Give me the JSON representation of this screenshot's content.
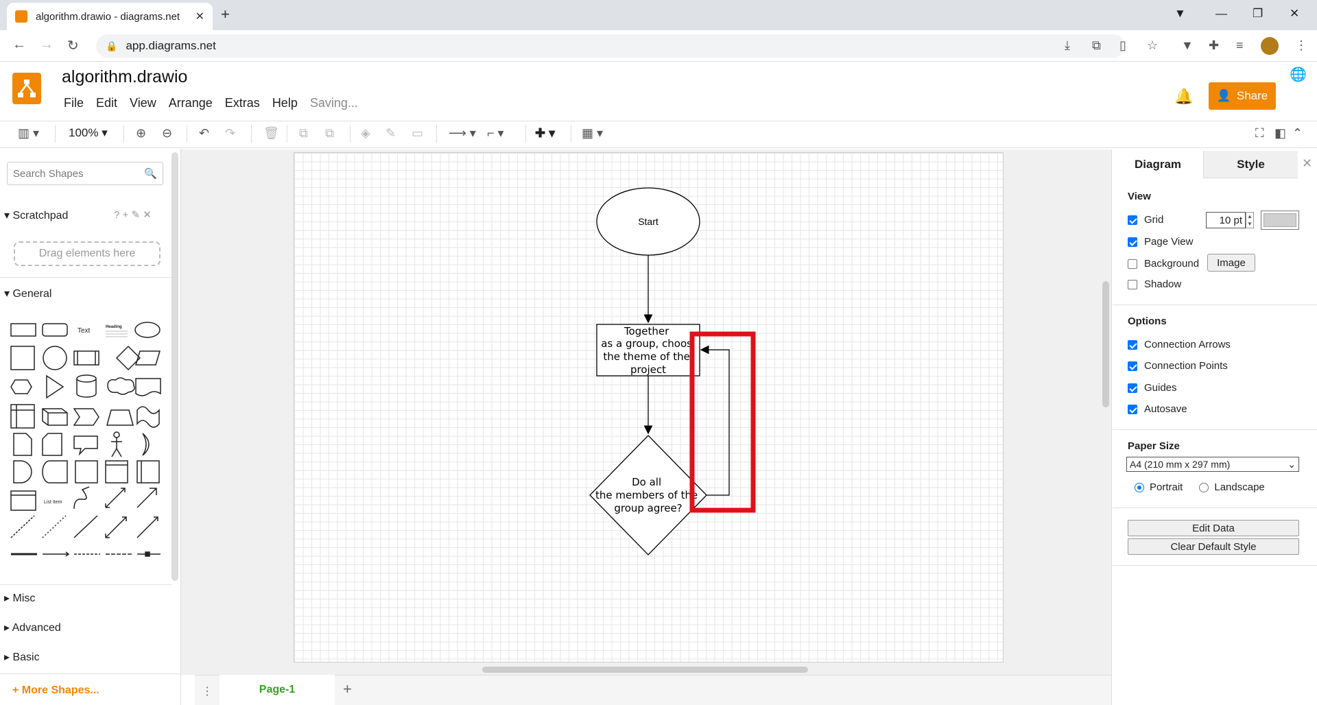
{
  "browser": {
    "tab_title": "algorithm.drawio - diagrams.net",
    "url": "app.diagrams.net"
  },
  "app": {
    "doc_title": "algorithm.drawio",
    "menu": [
      "File",
      "Edit",
      "View",
      "Arrange",
      "Extras",
      "Help"
    ],
    "status": "Saving...",
    "share_label": "Share"
  },
  "toolbar": {
    "zoom": "100%"
  },
  "left_panel": {
    "search_placeholder": "Search Shapes",
    "scratchpad": "Scratchpad",
    "scratchpad_help": "?",
    "drag_hint": "Drag elements here",
    "general": "General",
    "shape_text_label": "Text",
    "shape_heading_label": "Heading",
    "shape_list_item_label": "List Item",
    "sections": [
      "Misc",
      "Advanced",
      "Basic"
    ],
    "more_shapes": "More Shapes..."
  },
  "diagram": {
    "start": "Start",
    "process_lines": [
      "Together",
      "as a group, choos",
      "the theme of the",
      "project"
    ],
    "decision_lines": [
      "Do all",
      "the members of the",
      "group agree?"
    ],
    "highlight_color": "#e0101a"
  },
  "pages": {
    "current": "Page-1"
  },
  "right_panel": {
    "tab_diagram": "Diagram",
    "tab_style": "Style",
    "view_label": "View",
    "grid_label": "Grid",
    "grid_size": "10 pt",
    "page_view_label": "Page View",
    "background_label": "Background",
    "image_button": "Image",
    "shadow_label": "Shadow",
    "options_label": "Options",
    "connection_arrows": "Connection Arrows",
    "connection_points": "Connection Points",
    "guides": "Guides",
    "autosave": "Autosave",
    "paper_size_label": "Paper Size",
    "paper_size": "A4 (210 mm x 297 mm)",
    "portrait": "Portrait",
    "landscape": "Landscape",
    "edit_data": "Edit Data",
    "clear_default_style": "Clear Default Style"
  }
}
